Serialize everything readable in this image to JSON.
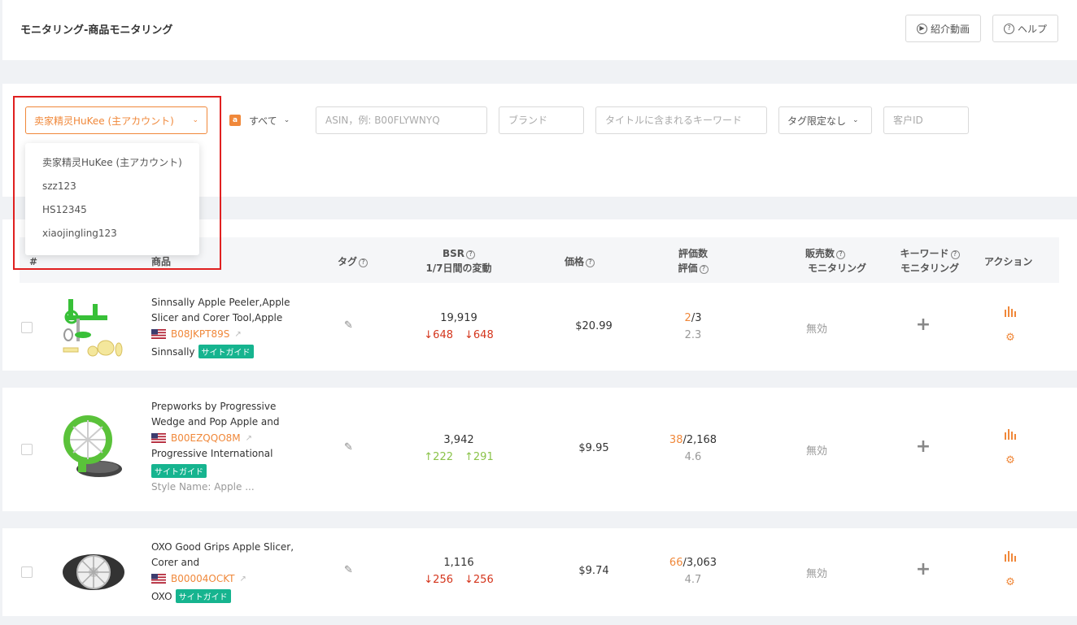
{
  "header": {
    "title": "モニタリング-商品モニタリング",
    "intro_video_label": "紹介動画",
    "help_label": "ヘルプ"
  },
  "filters": {
    "account_selected": "卖家精灵HuKee (主アカウント)",
    "marketplace_label": "すべて",
    "asin_placeholder": "ASIN，例: B00FLYWNYQ",
    "brand_placeholder": "ブランド",
    "title_keyword_placeholder": "タイトルに含まれるキーワード",
    "tag_label": "タグ限定なし",
    "customer_id_placeholder": "客户ID"
  },
  "account_dropdown": {
    "items": [
      "卖家精灵HuKee (主アカウント)",
      "szz123",
      "HS12345",
      "xiaojingling123"
    ]
  },
  "table": {
    "headers": {
      "index": "#",
      "product": "商品",
      "tag": "タグ",
      "bsr_line1": "BSR",
      "bsr_line2": "1/7日間の変動",
      "price": "価格",
      "reviews_line1": "評価数",
      "reviews_line2": "評価",
      "sales_line1": "販売数",
      "sales_line2": "モニタリング",
      "keyword_line1": "キーワード",
      "keyword_line2": "モニタリング",
      "action": "アクション"
    },
    "rows": [
      {
        "title": "Sinnsally Apple Peeler,Apple Slicer and Corer Tool,Apple",
        "asin": "B08JKPT89S",
        "brand": "Sinnsally",
        "badge": "サイトガイド",
        "style": "",
        "bsr": "19,919",
        "bsr_d1": "648",
        "bsr_d7": "648",
        "trend": "down",
        "price": "$20.99",
        "review_recent": "2",
        "review_total": "/3",
        "rating": "2.3",
        "sales_monitor": "無効"
      },
      {
        "title": "Prepworks by Progressive Wedge and Pop Apple and",
        "asin": "B00EZQQO8M",
        "brand": "Progressive International",
        "badge": "サイトガイド",
        "style": "Style Name: Apple ...",
        "bsr": "3,942",
        "bsr_d1": "222",
        "bsr_d7": "291",
        "trend": "up",
        "price": "$9.95",
        "review_recent": "38",
        "review_total": "/2,168",
        "rating": "4.6",
        "sales_monitor": "無効"
      },
      {
        "title": "OXO Good Grips Apple Slicer, Corer and",
        "asin": "B00004OCKT",
        "brand": "OXO",
        "badge": "サイトガイド",
        "style": "",
        "bsr": "1,116",
        "bsr_d1": "256",
        "bsr_d7": "256",
        "trend": "down",
        "price": "$9.74",
        "review_recent": "66",
        "review_total": "/3,063",
        "rating": "4.7",
        "sales_monitor": "無効"
      }
    ]
  },
  "colors": {
    "accent": "#f0883a",
    "down": "#d4351c",
    "up": "#8bc34a",
    "badge": "#16b48f",
    "highlight": "#e02020"
  }
}
